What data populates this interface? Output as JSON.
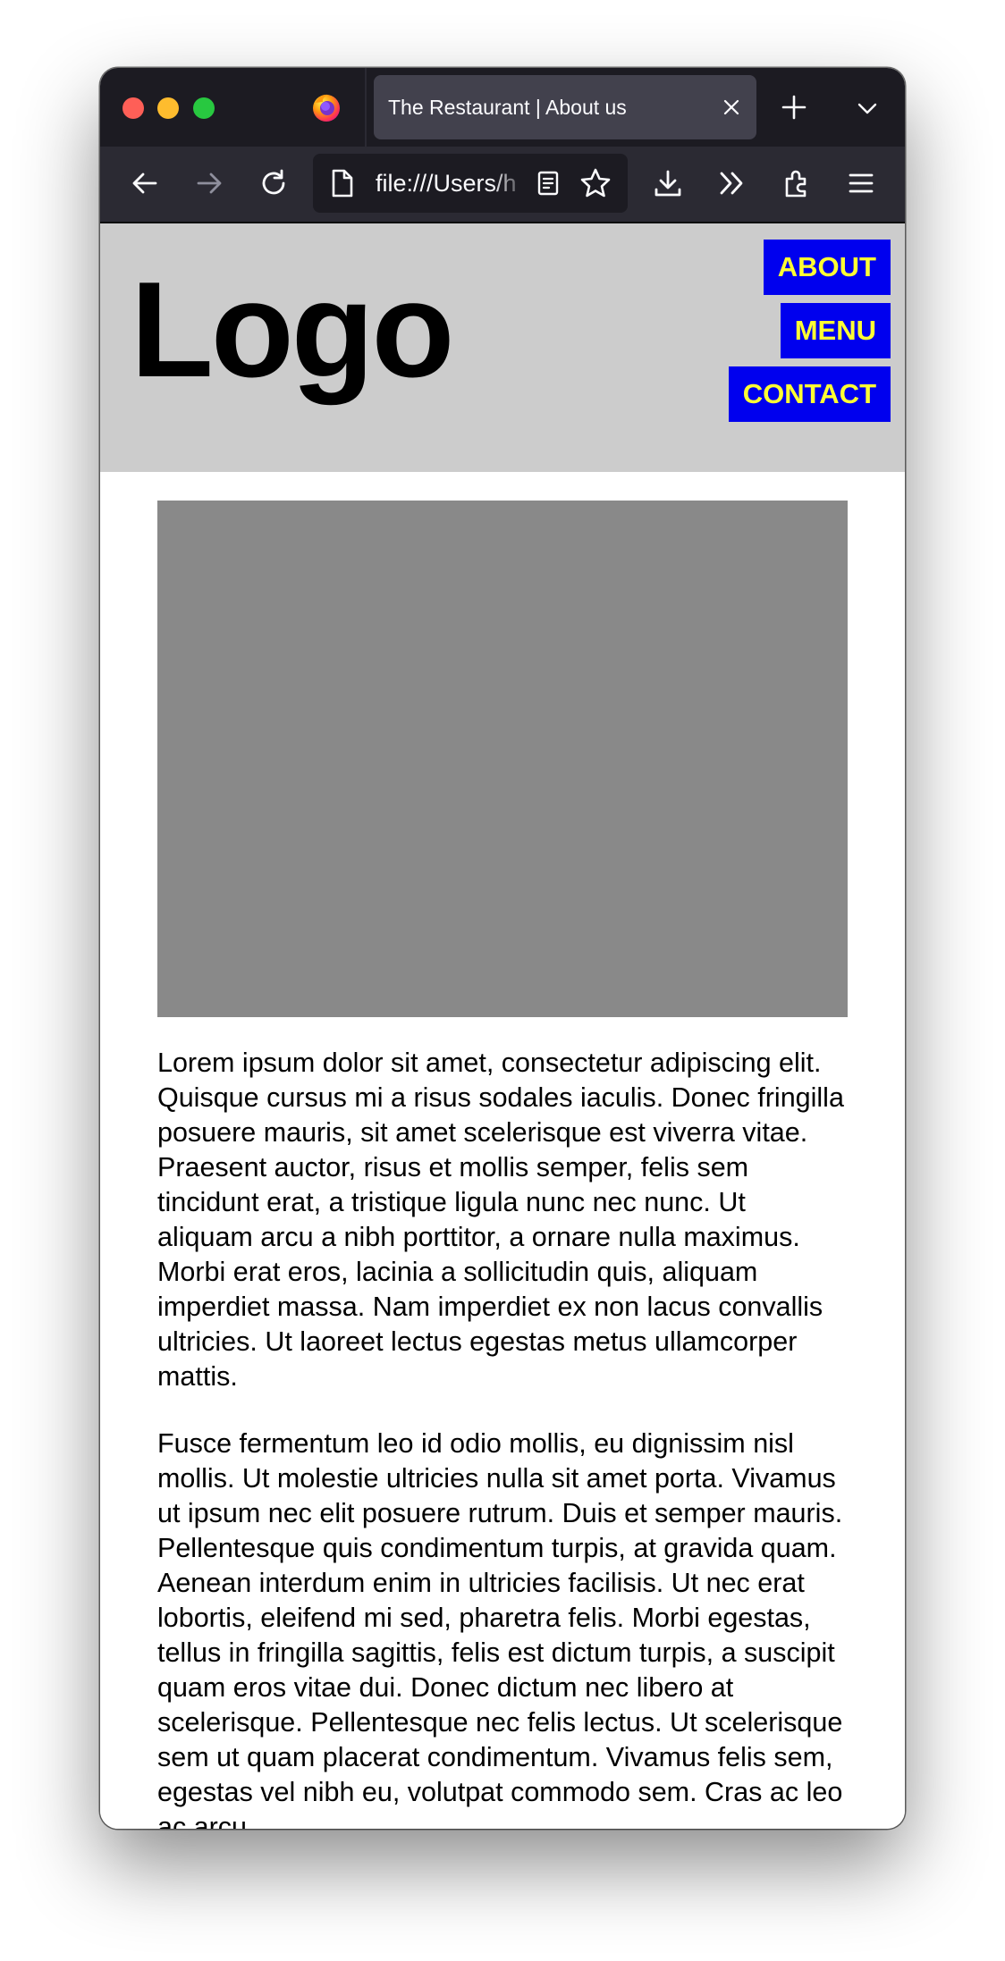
{
  "browser": {
    "tab_title": "The Restaurant | About us",
    "url": "file:///Users/h",
    "icons": [
      "firefox-icon",
      "close-icon",
      "plus-icon",
      "chevron-down-icon",
      "back-arrow-icon",
      "forward-arrow-icon",
      "reload-icon",
      "file-icon",
      "reader-view-icon",
      "star-icon",
      "download-icon",
      "overflow-chevrons-icon",
      "extensions-icon",
      "hamburger-menu-icon"
    ]
  },
  "site": {
    "logo": "Logo",
    "nav": {
      "about": "ABOUT",
      "menu": "MENU",
      "contact": "CONTACT"
    },
    "paragraphs": [
      "Lorem ipsum dolor sit amet, consectetur adipiscing elit. Quisque cursus mi a risus sodales iaculis. Donec fringilla posuere mauris, sit amet scelerisque est viverra vitae. Praesent auctor, risus et mollis semper, felis sem tincidunt erat, a tristique ligula nunc nec nunc. Ut aliquam arcu a nibh porttitor, a ornare nulla maximus. Morbi erat eros, lacinia a sollicitudin quis, aliquam imperdiet massa. Nam imperdiet ex non lacus convallis ultricies. Ut laoreet lectus egestas metus ullamcorper mattis.",
      "Fusce fermentum leo id odio mollis, eu dignissim nisl mollis. Ut molestie ultricies nulla sit amet porta. Vivamus ut ipsum nec elit posuere rutrum. Duis et semper mauris. Pellentesque quis condimentum turpis, at gravida quam. Aenean interdum enim in ultricies facilisis. Ut nec erat lobortis, eleifend mi sed, pharetra felis. Morbi egestas, tellus in fringilla sagittis, felis est dictum turpis, a suscipit quam eros vitae dui. Donec dictum nec libero at scelerisque. Pellentesque nec felis lectus. Ut scelerisque sem ut quam placerat condimentum. Vivamus felis sem, egestas vel nibh eu, volutpat commodo sem. Cras ac leo ac arcu"
    ]
  },
  "colors": {
    "header_bg": "#cccccc",
    "nav_bg": "#0000ee",
    "nav_text": "#ffff33",
    "image_placeholder": "#898989"
  }
}
